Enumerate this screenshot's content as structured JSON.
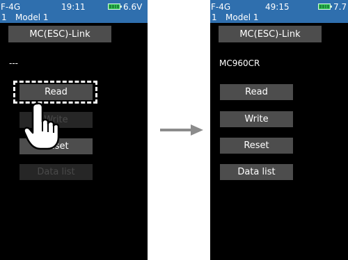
{
  "left_screen": {
    "status": {
      "transmitter": "F-4G",
      "time": "19:11",
      "voltage": "6.6V"
    },
    "model": {
      "number": "1",
      "name": "Model 1"
    },
    "title": "MC(ESC)-Link",
    "value": "---",
    "buttons": {
      "read": "Read",
      "write": "Write",
      "reset": "Reset",
      "data_list": "Data list"
    }
  },
  "right_screen": {
    "status": {
      "transmitter": "F-4G",
      "time": "49:15",
      "voltage": "7.7"
    },
    "model": {
      "number": "1",
      "name": "Model 1"
    },
    "title": "MC(ESC)-Link",
    "value": "MC960CR",
    "buttons": {
      "read": "Read",
      "write": "Write",
      "reset": "Reset",
      "data_list": "Data list"
    }
  },
  "icons": {
    "hand": "pointing-hand-icon",
    "arrow": "right-arrow-icon"
  },
  "colors": {
    "status_bar": "#2f6fae",
    "button": "#4d4d4d",
    "button_disabled": "#262626",
    "battery": "#34c759",
    "screen_bg": "#000000",
    "arrow": "#8c8c8c"
  }
}
